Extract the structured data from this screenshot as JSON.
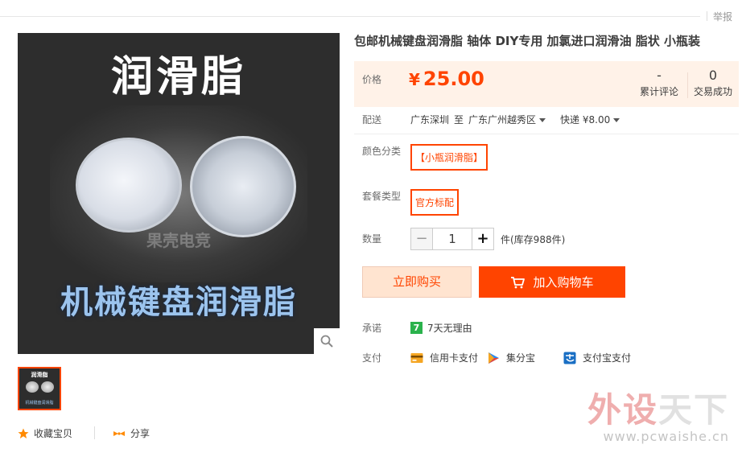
{
  "header": {
    "report_label": "举报"
  },
  "gallery": {
    "image_title_top": "润滑脂",
    "image_title_bottom": "机械键盘润滑脂",
    "image_watermark": "果壳电竞",
    "thumb_title": "润滑脂",
    "thumb_subtitle": "机械键盘润滑脂"
  },
  "actions": {
    "collect_label": "收藏宝贝",
    "share_label": "分享"
  },
  "product": {
    "title": "包邮机械键盘润滑脂 轴体 DIY专用 加氯进口润滑油 脂状 小瓶装"
  },
  "price": {
    "label": "价格",
    "currency": "¥",
    "value": "25.00",
    "reviews_count": "-",
    "reviews_label": "累计评论",
    "sales_count": "0",
    "sales_label": "交易成功"
  },
  "shipping": {
    "label": "配送",
    "from": "广东深圳",
    "to_word": "至",
    "to": "广东广州越秀区",
    "method": "快递 ¥8.00"
  },
  "options": {
    "color_label": "颜色分类",
    "color_value": "【小瓶润滑脂】",
    "package_label": "套餐类型",
    "package_value": "官方标配"
  },
  "quantity": {
    "label": "数量",
    "value": "1",
    "stock": "件(库存988件)",
    "minus": "−",
    "plus": "+"
  },
  "buttons": {
    "buy_now": "立即购买",
    "add_cart": "加入购物车"
  },
  "promise": {
    "label": "承诺",
    "badge": "7",
    "text": "7天无理由"
  },
  "payment": {
    "label": "支付",
    "methods": [
      "信用卡支付",
      "集分宝",
      "支付宝支付"
    ]
  },
  "site_watermark": {
    "name_a": "外设",
    "name_b": "天下",
    "url": "www.pcwaishe.cn"
  },
  "colors": {
    "accent": "#ff4400",
    "price_bg": "#fff2e8",
    "buy_bg": "#ffe4d0"
  }
}
